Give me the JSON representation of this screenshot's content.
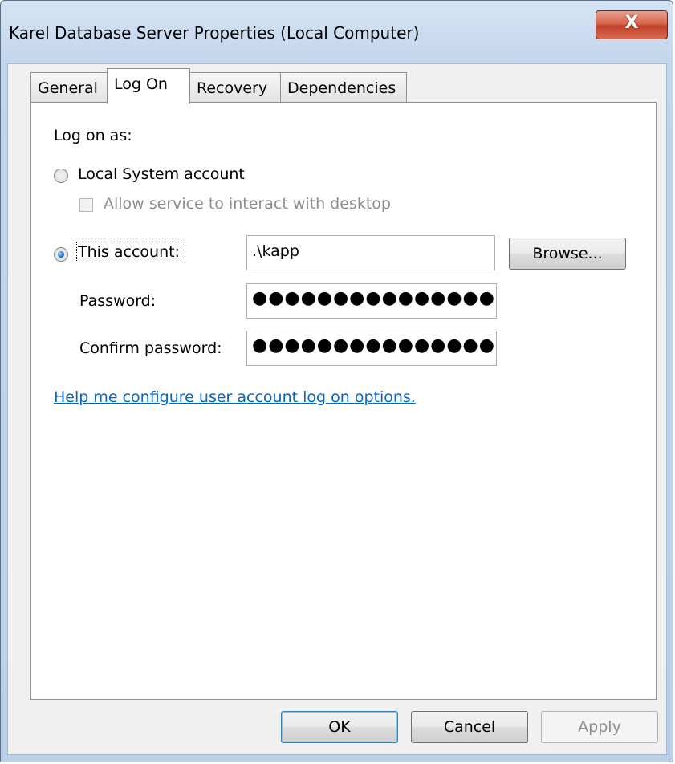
{
  "window": {
    "title": "Karel Database Server Properties (Local Computer)",
    "close_label": "X"
  },
  "tabs": [
    {
      "label": "General",
      "selected": false
    },
    {
      "label": "Log On",
      "selected": true
    },
    {
      "label": "Recovery",
      "selected": false
    },
    {
      "label": "Dependencies",
      "selected": false
    }
  ],
  "logon": {
    "log_on_as_label": "Log on as:",
    "local_system_label": "Local System account",
    "local_system_selected": false,
    "interact_desktop_label": "Allow service to interact with desktop",
    "interact_desktop_checked": false,
    "this_account_label": "This account:",
    "this_account_selected": true,
    "account_value": ".\\kapp",
    "browse_label": "Browse...",
    "password_label": "Password:",
    "password_value": "●●●●●●●●●●●●●●●",
    "confirm_password_label": "Confirm password:",
    "confirm_password_value": "●●●●●●●●●●●●●●●",
    "help_link": "Help me configure user account log on options."
  },
  "buttons": {
    "ok": "OK",
    "cancel": "Cancel",
    "apply": "Apply"
  },
  "colors": {
    "link": "#0066cc",
    "close_button": "#c1412a",
    "window_frame": "#c3d5ec"
  }
}
